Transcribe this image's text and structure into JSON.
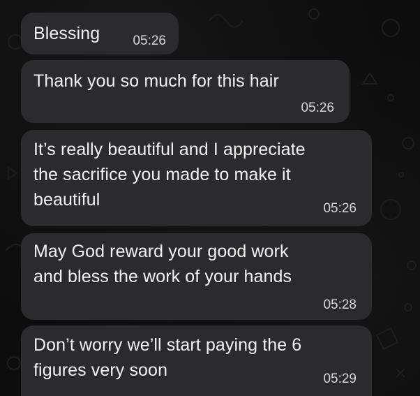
{
  "messages": [
    {
      "text": "Blessing",
      "time": "05:26"
    },
    {
      "text": "Thank you so much for this hair",
      "time": "05:26"
    },
    {
      "text": "It’s really beautiful and I appreciate\nthe sacrifice you made to make it\nbeautiful",
      "time": "05:26"
    },
    {
      "text": "May God reward your good work\nand bless the work of your hands",
      "time": "05:28"
    },
    {
      "text": "Don’t worry we’ll start paying the 6\nfigures very soon",
      "time": "05:29"
    }
  ],
  "colors": {
    "bubble": "#2b2b2d",
    "text": "#f2f2f2",
    "time": "#d7d7d7",
    "background": "#0b0b0b"
  },
  "icons": [
    "doodle-wallpaper-icon"
  ]
}
